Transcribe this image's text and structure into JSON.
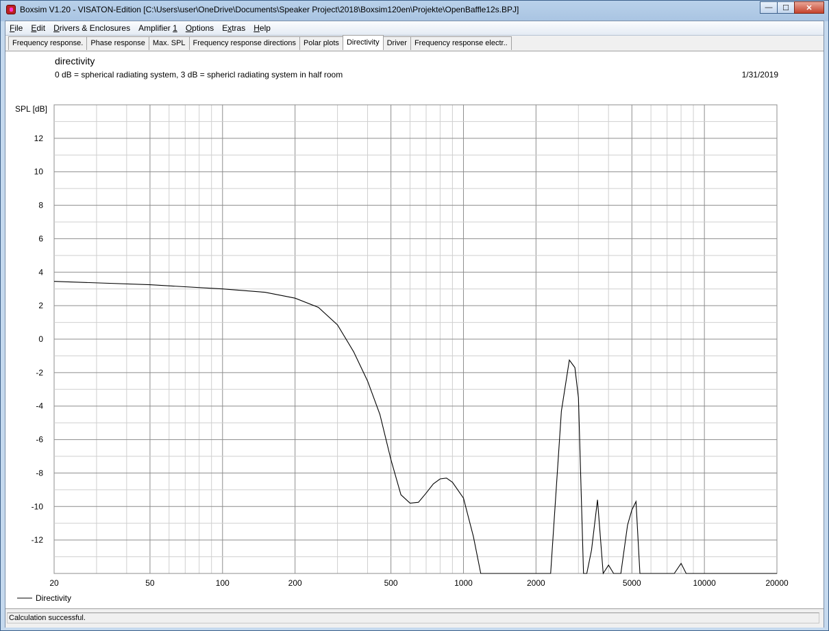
{
  "window": {
    "title": "Boxsim V1.20 - VISATON-Edition [C:\\Users\\user\\OneDrive\\Documents\\Speaker Project\\2018\\Boxsim120en\\Projekte\\OpenBaffle12s.BPJ]",
    "minimize": "0",
    "maximize": "1",
    "close": "r"
  },
  "menu": [
    {
      "u": "F",
      "rest": "ile"
    },
    {
      "u": "E",
      "rest": "dit"
    },
    {
      "u": "D",
      "rest": "rivers & Enclosures"
    },
    {
      "pre": "Amplifier ",
      "u": "1",
      "rest": ""
    },
    {
      "u": "O",
      "rest": "ptions"
    },
    {
      "pre": "E",
      "u": "x",
      "rest": "tras"
    },
    {
      "u": "H",
      "rest": "elp"
    }
  ],
  "tabs": [
    "Frequency response.",
    "Phase response",
    "Max. SPL",
    "Frequency response directions",
    "Polar plots",
    "Directivity",
    "Driver",
    "Frequency response electr.."
  ],
  "active_tab": 5,
  "chart_header": {
    "title": "directivity",
    "subtitle": "0 dB = spherical radiating system, 3 dB = sphericl radiating system in half room",
    "date": "1/31/2019"
  },
  "chart_data": {
    "type": "line",
    "title": "directivity",
    "xlabel": "",
    "ylabel": "SPL [dB]",
    "x_scale": "log",
    "xlim": [
      20,
      20000
    ],
    "ylim": [
      -14,
      14
    ],
    "x_ticks": [
      20,
      50,
      100,
      200,
      500,
      1000,
      2000,
      5000,
      10000,
      20000
    ],
    "y_ticks": [
      12,
      10,
      8,
      6,
      4,
      2,
      0,
      -2,
      -4,
      -6,
      -8,
      -10,
      -12
    ],
    "grid": true,
    "legend": "bottom-left",
    "line_color": "#000000",
    "series": [
      {
        "name": "Directivity",
        "x": [
          20,
          50,
          100,
          150,
          200,
          250,
          300,
          350,
          400,
          450,
          500,
          550,
          600,
          650,
          700,
          750,
          800,
          850,
          900,
          1000,
          1100,
          1180,
          1200,
          2000,
          2300,
          2550,
          2750,
          2900,
          3000,
          3150,
          3250,
          3400,
          3600,
          3800,
          4000,
          4200,
          4500,
          4800,
          5000,
          5200,
          5400,
          5600,
          6000,
          7500,
          8000,
          8400,
          10000,
          20000
        ],
        "y": [
          3.45,
          3.25,
          3.0,
          2.8,
          2.45,
          1.9,
          0.85,
          -0.75,
          -2.5,
          -4.5,
          -7.2,
          -9.3,
          -9.8,
          -9.75,
          -9.2,
          -8.65,
          -8.35,
          -8.3,
          -8.55,
          -9.5,
          -11.8,
          -14,
          -14,
          -14,
          -14,
          -4.3,
          -1.25,
          -1.7,
          -3.5,
          -14,
          -14,
          -12.6,
          -9.6,
          -14,
          -13.5,
          -14,
          -14,
          -11.1,
          -10.2,
          -9.7,
          -14,
          -14,
          -14,
          -14,
          -13.4,
          -14,
          -14,
          -14
        ]
      }
    ]
  },
  "status": "Calculation successful."
}
